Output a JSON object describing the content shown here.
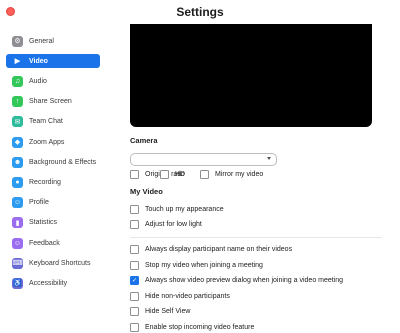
{
  "window": {
    "title": "Settings"
  },
  "sidebar": {
    "items": [
      {
        "label": "General",
        "icon": "gear-icon",
        "glyph": "⚙",
        "color": "#8e8e93",
        "active": false
      },
      {
        "label": "Video",
        "icon": "video-camera-icon",
        "glyph": "▶",
        "color": "#1a73e8",
        "active": true
      },
      {
        "label": "Audio",
        "icon": "headphones-icon",
        "glyph": "♫",
        "color": "#34c759",
        "active": false
      },
      {
        "label": "Share Screen",
        "icon": "share-screen-icon",
        "glyph": "↑",
        "color": "#34c759",
        "active": false
      },
      {
        "label": "Team Chat",
        "icon": "chat-icon",
        "glyph": "✉",
        "color": "#2dbb9b",
        "active": false
      },
      {
        "label": "Zoom Apps",
        "icon": "apps-icon",
        "glyph": "◆",
        "color": "#2d9bf0",
        "active": false
      },
      {
        "label": "Background & Effects",
        "icon": "person-background-icon",
        "glyph": "☻",
        "color": "#2d9bf0",
        "active": false
      },
      {
        "label": "Recording",
        "icon": "record-icon",
        "glyph": "●",
        "color": "#2d9bf0",
        "active": false
      },
      {
        "label": "Profile",
        "icon": "profile-icon",
        "glyph": "☺",
        "color": "#2d9bf0",
        "active": false
      },
      {
        "label": "Statistics",
        "icon": "statistics-icon",
        "glyph": "▮",
        "color": "#9a6cf0",
        "active": false
      },
      {
        "label": "Feedback",
        "icon": "feedback-icon",
        "glyph": "☺",
        "color": "#9a6cf0",
        "active": false
      },
      {
        "label": "Keyboard Shortcuts",
        "icon": "keyboard-icon",
        "glyph": "⌨",
        "color": "#6b6bd6",
        "active": false
      },
      {
        "label": "Accessibility",
        "icon": "accessibility-icon",
        "glyph": "♿",
        "color": "#6b6bd6",
        "active": false
      }
    ]
  },
  "camera": {
    "heading": "Camera",
    "selected": ""
  },
  "camera_options": [
    {
      "label": "Original ratio",
      "checked": false
    },
    {
      "label": "HD",
      "checked": false
    },
    {
      "label": "Mirror my video",
      "checked": false
    }
  ],
  "my_video": {
    "heading": "My Video",
    "options": [
      {
        "label": "Touch up my appearance",
        "checked": false
      },
      {
        "label": "Adjust for low light",
        "checked": false
      }
    ]
  },
  "general_options": [
    {
      "label": "Always display participant name on their videos",
      "checked": false
    },
    {
      "label": "Stop my video when joining a meeting",
      "checked": false
    },
    {
      "label": "Always show video preview dialog when joining a video meeting",
      "checked": true
    },
    {
      "label": "Hide non-video participants",
      "checked": false
    },
    {
      "label": "Hide Self View",
      "checked": false
    },
    {
      "label": "Enable stop incoming video feature",
      "checked": false
    }
  ],
  "colors": {
    "accent": "#1a73e8",
    "close": "#ff5f57"
  }
}
